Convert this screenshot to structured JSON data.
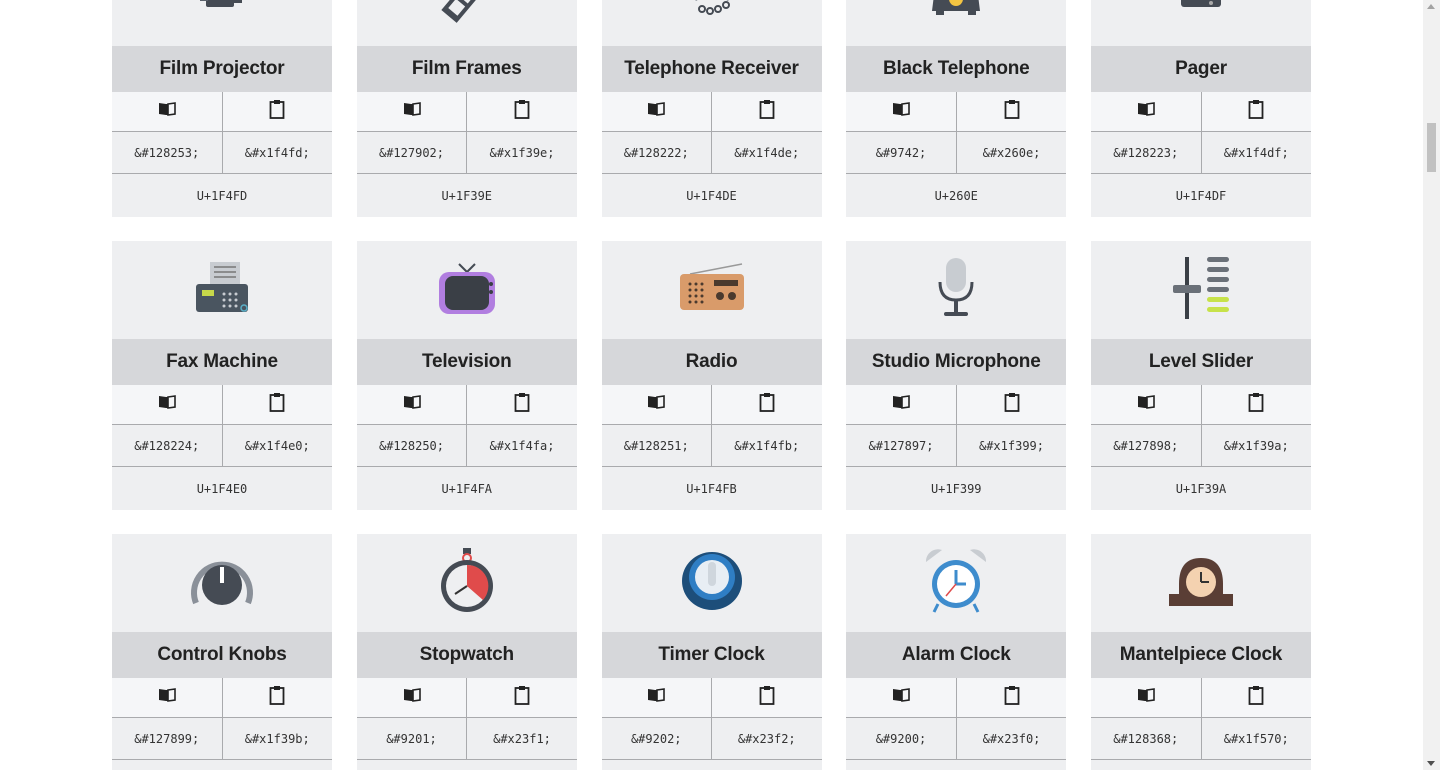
{
  "cards": [
    {
      "name": "Film Projector",
      "icon": "film-projector-icon",
      "decimal": "&#128253;",
      "hex": "&#x1f4fd;",
      "unicode": "U+1F4FD"
    },
    {
      "name": "Film Frames",
      "icon": "film-frames-icon",
      "decimal": "&#127902;",
      "hex": "&#x1f39e;",
      "unicode": "U+1F39E"
    },
    {
      "name": "Telephone Receiver",
      "icon": "telephone-receiver-icon",
      "decimal": "&#128222;",
      "hex": "&#x1f4de;",
      "unicode": "U+1F4DE"
    },
    {
      "name": "Black Telephone",
      "icon": "black-telephone-icon",
      "decimal": "&#9742;",
      "hex": "&#x260e;",
      "unicode": "U+260E"
    },
    {
      "name": "Pager",
      "icon": "pager-icon",
      "decimal": "&#128223;",
      "hex": "&#x1f4df;",
      "unicode": "U+1F4DF"
    },
    {
      "name": "Fax Machine",
      "icon": "fax-machine-icon",
      "decimal": "&#128224;",
      "hex": "&#x1f4e0;",
      "unicode": "U+1F4E0"
    },
    {
      "name": "Television",
      "icon": "television-icon",
      "decimal": "&#128250;",
      "hex": "&#x1f4fa;",
      "unicode": "U+1F4FA"
    },
    {
      "name": "Radio",
      "icon": "radio-icon",
      "decimal": "&#128251;",
      "hex": "&#x1f4fb;",
      "unicode": "U+1F4FB"
    },
    {
      "name": "Studio Microphone",
      "icon": "studio-microphone-icon",
      "decimal": "&#127897;",
      "hex": "&#x1f399;",
      "unicode": "U+1F399"
    },
    {
      "name": "Level Slider",
      "icon": "level-slider-icon",
      "decimal": "&#127898;",
      "hex": "&#x1f39a;",
      "unicode": "U+1F39A"
    },
    {
      "name": "Control Knobs",
      "icon": "control-knobs-icon",
      "decimal": "&#127899;",
      "hex": "&#x1f39b;",
      "unicode": ""
    },
    {
      "name": "Stopwatch",
      "icon": "stopwatch-icon",
      "decimal": "&#9201;",
      "hex": "&#x23f1;",
      "unicode": ""
    },
    {
      "name": "Timer Clock",
      "icon": "timer-clock-icon",
      "decimal": "&#9202;",
      "hex": "&#x23f2;",
      "unicode": ""
    },
    {
      "name": "Alarm Clock",
      "icon": "alarm-clock-icon",
      "decimal": "&#9200;",
      "hex": "&#x23f0;",
      "unicode": ""
    },
    {
      "name": "Mantelpiece Clock",
      "icon": "mantelpiece-clock-icon",
      "decimal": "&#128368;",
      "hex": "&#x1f570;",
      "unicode": ""
    }
  ],
  "actions": {
    "copy_icon": "book-icon",
    "clipboard_icon": "clipboard-icon"
  },
  "colors": {
    "card_bg": "#eeeff1",
    "title_bg": "#d6d7da",
    "divider": "#a9aaad"
  }
}
